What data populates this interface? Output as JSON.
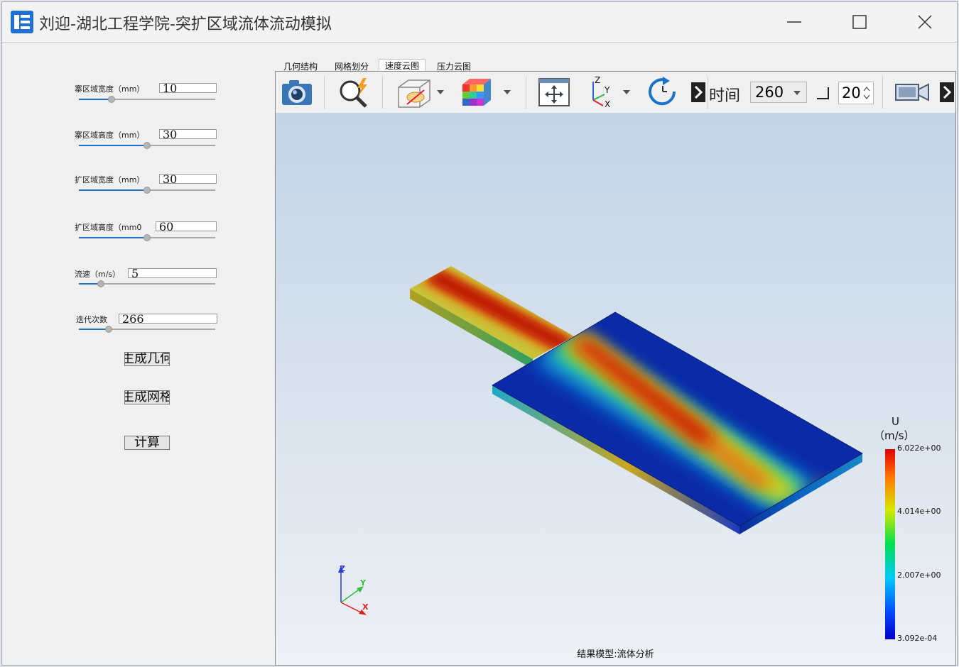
{
  "window": {
    "title": "刘迎-湖北工程学院-突扩区域流体流动模拟",
    "colors": {
      "accent": "#1a73c9",
      "icon_blue": "#1e6fd6"
    }
  },
  "params": [
    {
      "label": "寨区域宽度（mm）",
      "value": "10",
      "slider_fraction": 0.24
    },
    {
      "label": "寨区域高度（mm）",
      "value": "30",
      "slider_fraction": 0.5
    },
    {
      "label": "扩区域宽度（mm）",
      "value": "30",
      "slider_fraction": 0.5
    },
    {
      "label": "扩区域高度（mm0",
      "value": "60",
      "slider_fraction": 0.5
    },
    {
      "label": "流速（m/s）",
      "value": "5",
      "slider_fraction": 0.16
    },
    {
      "label": "迭代次数",
      "value": "266",
      "slider_fraction": 0.22
    }
  ],
  "buttons": {
    "gen_geometry": "生成几何",
    "gen_mesh": "生成网格",
    "compute": "计算"
  },
  "tabs": [
    "几何结构",
    "网格划分",
    "速度云图",
    "压力云图"
  ],
  "active_tab": "速度云图",
  "toolbar": {
    "icons": [
      "camera-icon",
      "zoom-icon",
      "visibility-icon",
      "colormap-cube-icon",
      "fit-view-icon",
      "axes-icon",
      "rotate-icon",
      "camera-video-icon"
    ],
    "time_label": "时间",
    "time_value": "260",
    "step_value": "20"
  },
  "legend": {
    "title": "U",
    "unit": "（m/s）",
    "ticks": [
      "6.022e+00",
      "4.014e+00",
      "2.007e+00",
      "3.092e-04"
    ]
  },
  "axes": {
    "z": "Z",
    "y": "Y",
    "x": "X"
  },
  "caption": "结果模型:流体分析"
}
